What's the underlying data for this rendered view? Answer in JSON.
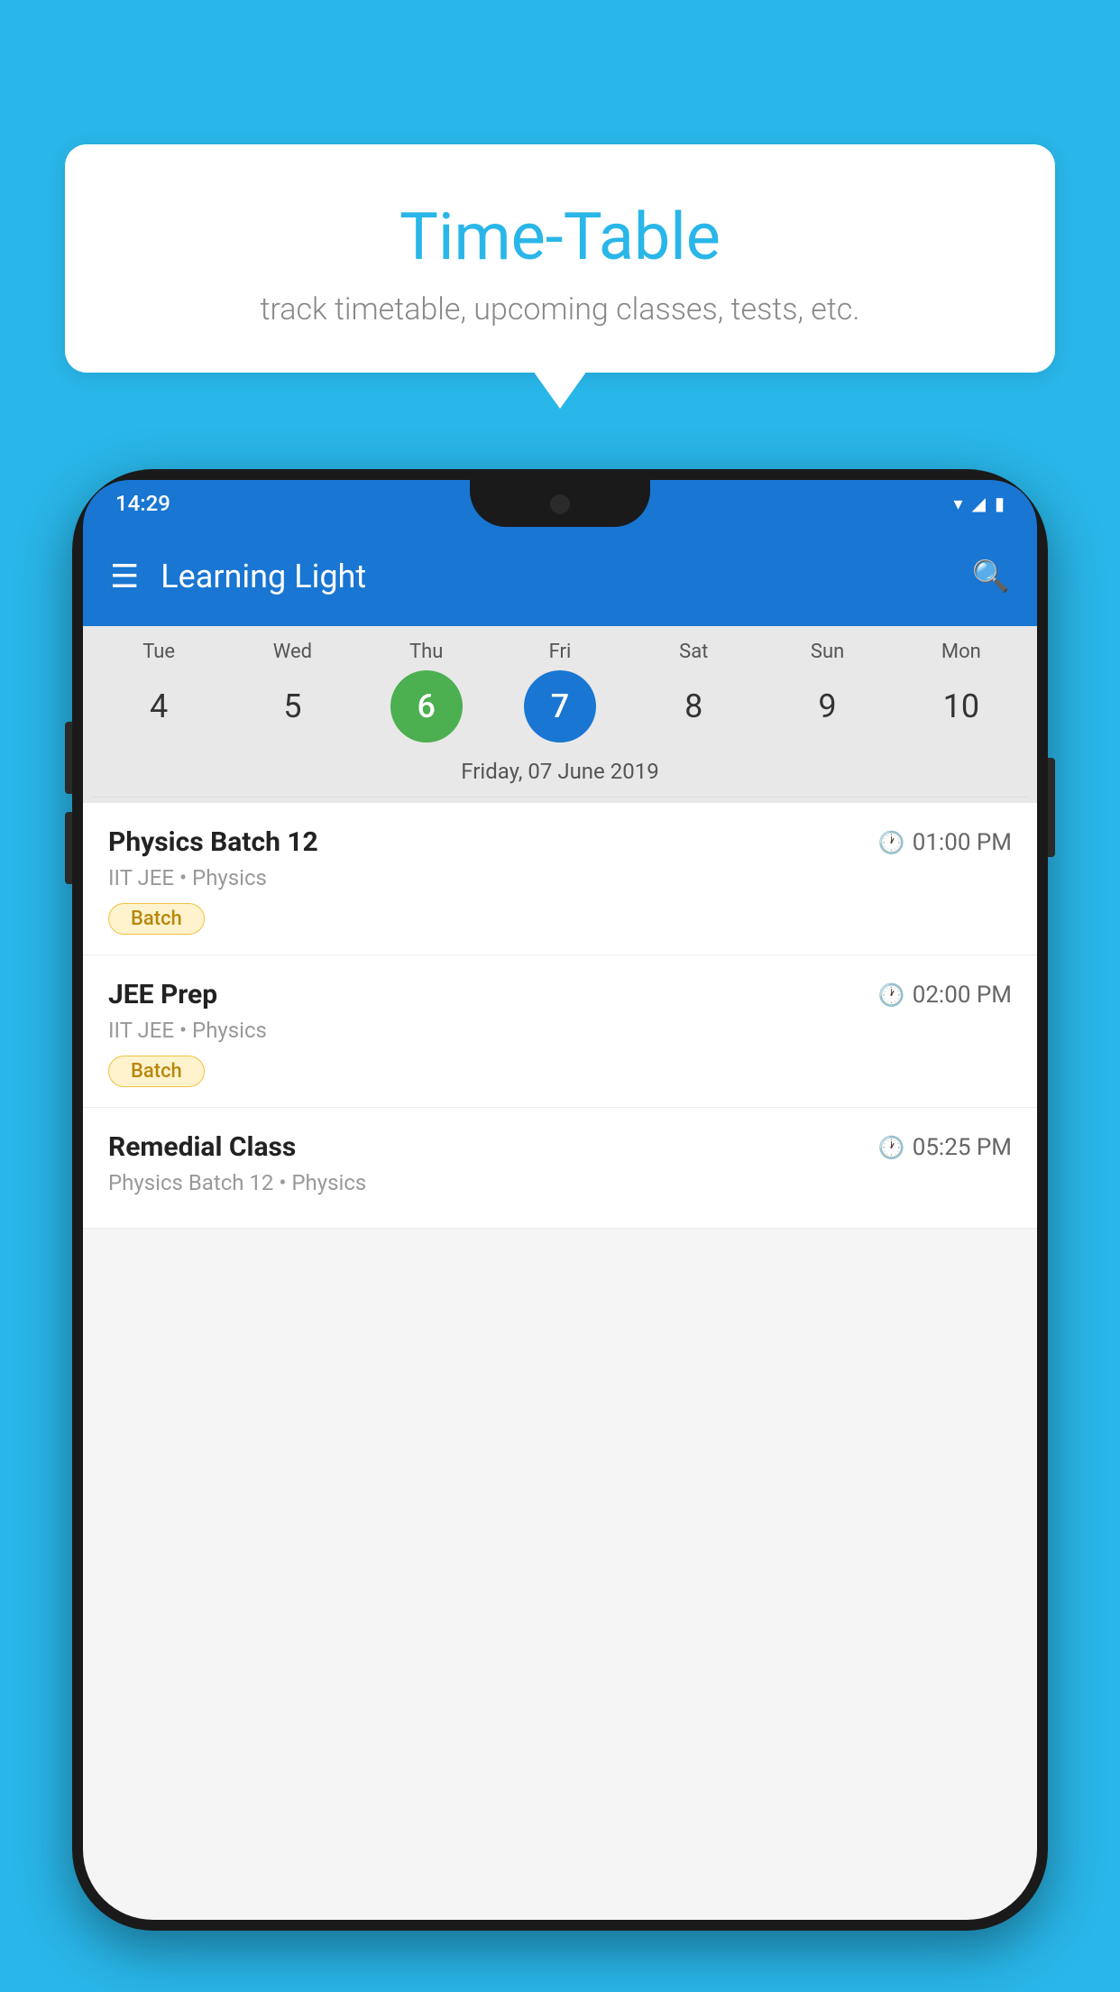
{
  "background_color": "#29b6e8",
  "tooltip": {
    "title": "Time-Table",
    "subtitle": "track timetable, upcoming classes, tests, etc."
  },
  "phone": {
    "status_bar": {
      "time": "14:29",
      "icons": [
        "wifi",
        "signal",
        "battery"
      ]
    },
    "app_bar": {
      "title": "Learning Light",
      "menu_icon": "☰",
      "search_icon": "🔍"
    },
    "calendar": {
      "days": [
        {
          "abbr": "Tue",
          "num": "4",
          "state": "normal"
        },
        {
          "abbr": "Wed",
          "num": "5",
          "state": "normal"
        },
        {
          "abbr": "Thu",
          "num": "6",
          "state": "today"
        },
        {
          "abbr": "Fri",
          "num": "7",
          "state": "selected"
        },
        {
          "abbr": "Sat",
          "num": "8",
          "state": "normal"
        },
        {
          "abbr": "Sun",
          "num": "9",
          "state": "normal"
        },
        {
          "abbr": "Mon",
          "num": "10",
          "state": "normal"
        }
      ],
      "selected_date_label": "Friday, 07 June 2019"
    },
    "classes": [
      {
        "name": "Physics Batch 12",
        "time": "01:00 PM",
        "subtitle": "IIT JEE • Physics",
        "badge": "Batch"
      },
      {
        "name": "JEE Prep",
        "time": "02:00 PM",
        "subtitle": "IIT JEE • Physics",
        "badge": "Batch"
      },
      {
        "name": "Remedial Class",
        "time": "05:25 PM",
        "subtitle": "Physics Batch 12 • Physics",
        "badge": null
      }
    ]
  }
}
